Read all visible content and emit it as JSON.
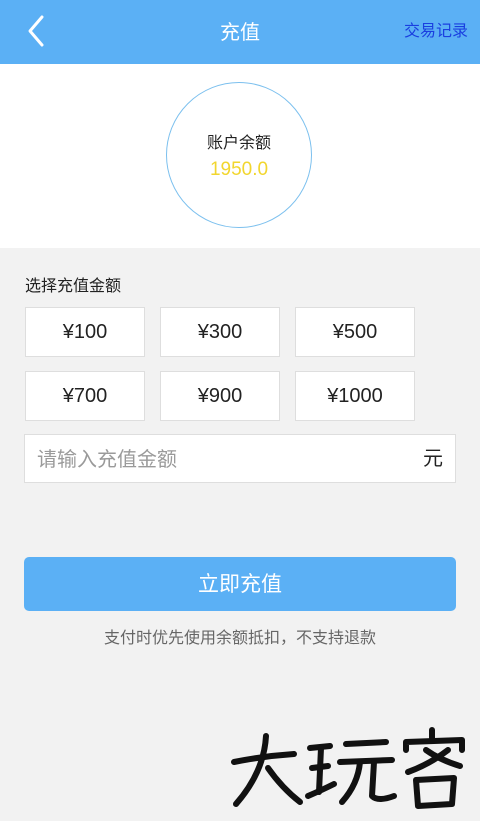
{
  "header": {
    "back_icon": "chevron-left-icon",
    "title": "充值",
    "link": "交易记录"
  },
  "balance": {
    "label": "账户余额",
    "value": "1950.0"
  },
  "amount_section": {
    "label": "选择充值金额",
    "options": [
      "¥100",
      "¥300",
      "¥500",
      "¥700",
      "¥900",
      "¥1000"
    ]
  },
  "custom_amount": {
    "placeholder": "请输入充值金额",
    "value": "",
    "unit": "元"
  },
  "submit": {
    "label": "立即充值"
  },
  "note": "支付时优先使用余额抵扣，不支持退款",
  "watermark": "大玩客",
  "colors": {
    "primary": "#5bb0f5",
    "link": "#1a3fe0",
    "balance_value": "#f2d62e",
    "background": "#f2f2f2"
  }
}
